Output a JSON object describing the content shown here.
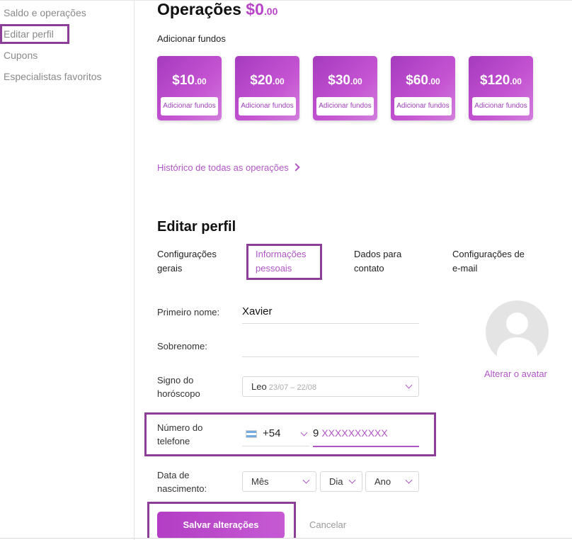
{
  "sidebar": {
    "items": [
      {
        "label": "Saldo e operações"
      },
      {
        "label": "Editar perfil"
      },
      {
        "label": "Cupons"
      },
      {
        "label": "Especialistas favoritos"
      }
    ]
  },
  "operations": {
    "title": "Operações",
    "balance_main": "$0",
    "balance_cents": ".00",
    "add_funds_title": "Adicionar fundos",
    "cards": [
      {
        "amount": "$10",
        "cents": ".00",
        "button": "Adicionar fundos"
      },
      {
        "amount": "$20",
        "cents": ".00",
        "button": "Adicionar fundos"
      },
      {
        "amount": "$30",
        "cents": ".00",
        "button": "Adicionar fundos"
      },
      {
        "amount": "$60",
        "cents": ".00",
        "button": "Adicionar fundos"
      },
      {
        "amount": "$120",
        "cents": ".00",
        "button": "Adicionar fundos"
      }
    ],
    "history_link": "Histórico de todas as operações"
  },
  "profile": {
    "title": "Editar perfil",
    "tabs": [
      {
        "line1": "Configurações",
        "line2": "gerais"
      },
      {
        "line1": "Informações",
        "line2": "pessoais"
      },
      {
        "line1": "Dados para",
        "line2": "contato"
      },
      {
        "line1": "Configurações de",
        "line2": "e-mail"
      }
    ],
    "first_name_label": "Primeiro nome:",
    "first_name_value": "Xavier",
    "last_name_label": "Sobrenome:",
    "last_name_value": "",
    "horoscope_label_1": "Signo do",
    "horoscope_label_2": "horóscopo",
    "horoscope_value": "Leo",
    "horoscope_hint": "23/07 – 22/08",
    "phone_label_1": "Número do",
    "phone_label_2": "telefone",
    "phone_code": "+54",
    "phone_prefix": "9",
    "phone_placeholder": "XXXXXXXXXX",
    "birth_label_1": "Data de",
    "birth_label_2": "nascimento:",
    "birth_month": "Mês",
    "birth_day": "Dia",
    "birth_year": "Ano",
    "change_avatar": "Alterar o avatar",
    "save_button": "Salvar alterações",
    "cancel": "Cancelar"
  },
  "colors": {
    "accent": "#b845c8",
    "highlight_box": "#8b3f97",
    "link": "#b056c4"
  }
}
